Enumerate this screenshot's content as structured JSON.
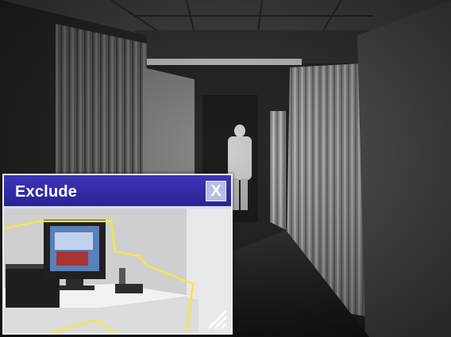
{
  "window": {
    "title": "Exclude",
    "close_label": "X"
  },
  "icons": {
    "close": "close-icon",
    "resize": "resize-grip-icon"
  },
  "colors": {
    "title_bar": "#2b2294",
    "exclusion_outline": "#f2e84a"
  }
}
